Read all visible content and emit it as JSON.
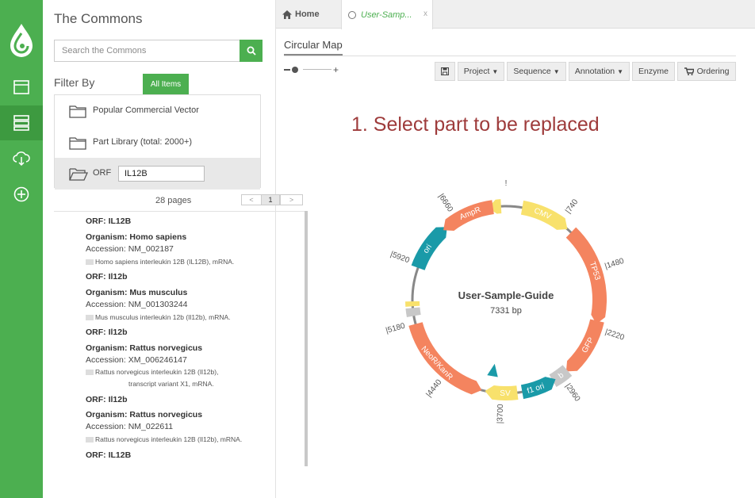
{
  "commons": {
    "title": "The Commons",
    "search_placeholder": "Search the Commons",
    "filter_label": "Filter By",
    "filter_chip": "All Items",
    "tree": [
      {
        "label": "Popular Commercial Vector"
      },
      {
        "label": "Part Library (total: 2000+)"
      },
      {
        "label": "ORF",
        "value": "IL12B"
      }
    ],
    "pager": {
      "pages": "28 pages",
      "prev": "<",
      "current": "1",
      "next": ">"
    },
    "results": [
      {
        "orf": "ORF: IL12B",
        "organism": "Organism: Homo sapiens",
        "accession": "Accession: NM_002187",
        "desc": [
          "Homo sapiens interleukin 12B (IL12B), mRNA."
        ]
      },
      {
        "orf": "ORF: Il12b",
        "organism": "Organism: Mus musculus",
        "accession": "Accession: NM_001303244",
        "desc": [
          "Mus musculus interleukin 12b (Il12b), mRNA."
        ]
      },
      {
        "orf": "ORF: Il12b",
        "organism": "Organism: Rattus norvegicus",
        "accession": "Accession: XM_006246147",
        "desc": [
          "Rattus norvegicus interleukin 12B (Il12b),",
          "transcript variant X1, mRNA."
        ]
      },
      {
        "orf": "ORF: Il12b",
        "organism": "Organism: Rattus norvegicus",
        "accession": "Accession: NM_022611",
        "desc": [
          "Rattus norvegicus interleukin 12B (Il12b), mRNA."
        ]
      },
      {
        "orf": "ORF: IL12B"
      }
    ]
  },
  "tabs": {
    "home": "Home",
    "doc": "User-Samp...",
    "close": "x"
  },
  "main": {
    "section_title": "Circular Map",
    "zoom_plus": "+",
    "toolbar": [
      {
        "label": "",
        "icon": "save-icon"
      },
      {
        "label": "Project",
        "caret": true
      },
      {
        "label": "Sequence",
        "caret": true
      },
      {
        "label": "Annotation",
        "caret": true
      },
      {
        "label": "Enzyme"
      },
      {
        "label": "Ordering",
        "icon": "cart-icon"
      }
    ],
    "headline": "1. Select part to be replaced"
  },
  "map": {
    "name": "User-Sample-Guide",
    "length": "7331 bp",
    "ticks": [
      "|740",
      "|1480",
      "|2220",
      "|2960",
      "|3700",
      "|4440",
      "|5180",
      "|5920",
      "|6660",
      "!"
    ],
    "features": [
      "CMV",
      "TP53",
      "GFP",
      "f1 ori",
      "SV",
      "NeoR/KanR",
      "ori",
      "AmpR",
      "b"
    ],
    "colors": {
      "orange": "#f4845f",
      "teal": "#1a9aa8",
      "yellow": "#f8e16c",
      "grey": "#c8c8c8",
      "ring": "#888888"
    }
  },
  "colors": {
    "accent": "#4caf50",
    "headline": "#9e3b3b"
  }
}
